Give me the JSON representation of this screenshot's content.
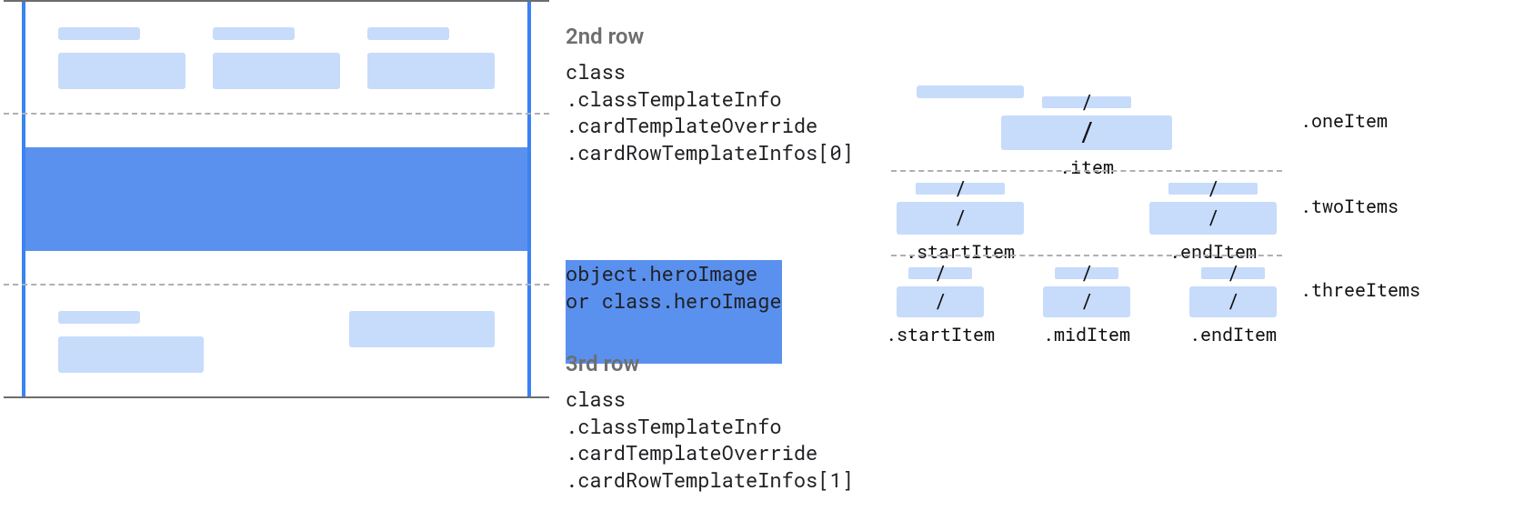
{
  "left": {
    "rows": {
      "second": {
        "heading": "2nd row",
        "lines": [
          "class",
          ".classTemplateInfo",
          ".cardTemplateOverride",
          ".cardRowTemplateInfos[0]"
        ]
      },
      "hero": {
        "lines": [
          "object.heroImage",
          "or class.heroImage"
        ]
      },
      "third": {
        "heading": "3rd row",
        "lines": [
          "class",
          ".classTemplateInfo",
          ".cardTemplateOverride",
          ".cardRowTemplateInfos[1]"
        ]
      }
    }
  },
  "right": {
    "one": {
      "label": ".oneItem",
      "items": [
        ".item"
      ]
    },
    "two": {
      "label": ".twoItems",
      "items": [
        ".startItem",
        ".endItem"
      ]
    },
    "three": {
      "label": ".threeItems",
      "items": [
        ".startItem",
        ".midItem",
        ".endItem"
      ]
    }
  }
}
